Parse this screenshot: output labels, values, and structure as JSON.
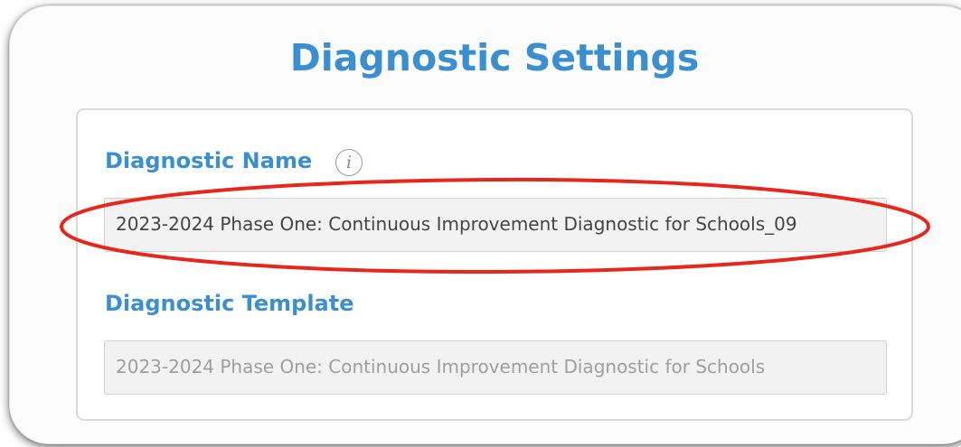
{
  "page": {
    "title": "Diagnostic Settings"
  },
  "fields": {
    "diagnostic_name": {
      "label": "Diagnostic Name",
      "info_icon": "info-icon",
      "value": "2023-2024 Phase One: Continuous Improvement Diagnostic for Schools_09"
    },
    "diagnostic_template": {
      "label": "Diagnostic Template",
      "value": "2023-2024 Phase One: Continuous Improvement Diagnostic for Schools"
    }
  },
  "annotation": {
    "highlight_color": "#e8261c"
  },
  "colors": {
    "accent": "#3a8fd0",
    "field_background": "#f2f2f2"
  }
}
